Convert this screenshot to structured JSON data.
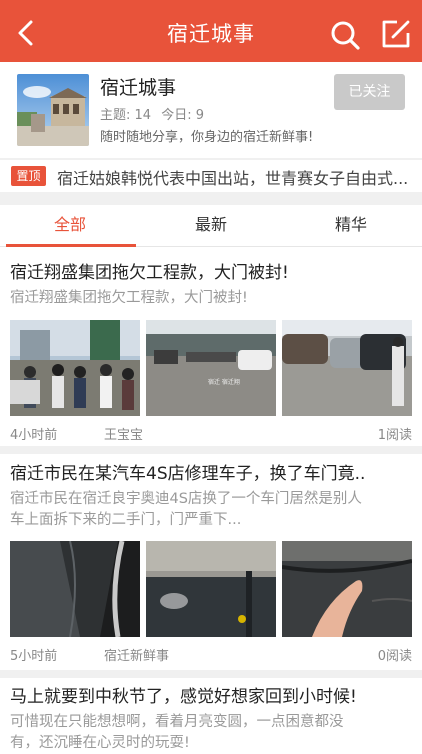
{
  "header": {
    "title": "宿迁城事",
    "colors": {
      "accent": "#e8533a"
    }
  },
  "board": {
    "name": "宿迁城事",
    "topics_label": "主题: 14",
    "today_label": "今日: 9",
    "description": "随时随地分享，你身边的宿迁新鲜事!",
    "follow_label": "已关注"
  },
  "pinned": {
    "tag": "置顶",
    "text": "宿迁姑娘韩悦代表中国出站，世青赛女子自由式..."
  },
  "tabs": [
    {
      "label": "全部",
      "active": true
    },
    {
      "label": "最新",
      "active": false
    },
    {
      "label": "精华",
      "active": false
    }
  ],
  "posts": [
    {
      "title": "宿迁翔盛集团拖欠工程款，大门被封!",
      "excerpt": "宿迁翔盛集团拖欠工程款，大门被封!",
      "time": "4小时前",
      "author": "王宝宝",
      "reads": "1阅读",
      "image_watermark": "宿迁 宿迁翔"
    },
    {
      "title": "宿迁市民在某汽车4S店修理车子，换了车门竟..",
      "excerpt_line1": "宿迁市民在宿迁良宇奥迪4S店换了一个车门居然是别人",
      "excerpt_line2": "车上面拆下来的二手门，门严重下...",
      "time": "5小时前",
      "author": "宿迁新鲜事",
      "reads": "0阅读"
    },
    {
      "title": "马上就要到中秋节了，感觉好想家回到小时候!",
      "excerpt_line1": "可惜现在只能想想啊，看着月亮变圆，一点困意都没",
      "excerpt_line2": "有，还沉睡在心灵时的玩耍!"
    }
  ]
}
